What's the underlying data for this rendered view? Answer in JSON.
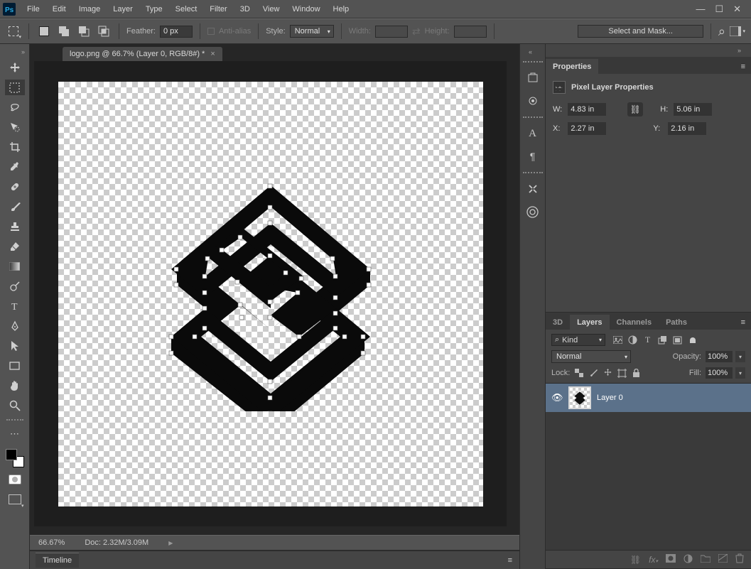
{
  "app": {
    "menus": [
      "File",
      "Edit",
      "Image",
      "Layer",
      "Type",
      "Select",
      "Filter",
      "3D",
      "View",
      "Window",
      "Help"
    ]
  },
  "options": {
    "feather_label": "Feather:",
    "feather_value": "0 px",
    "antialias_label": "Anti-alias",
    "style_label": "Style:",
    "style_value": "Normal",
    "width_label": "Width:",
    "height_label": "Height:",
    "select_mask": "Select and Mask..."
  },
  "document": {
    "tab_title": "logo.png @ 66.7% (Layer 0, RGB/8#) *"
  },
  "status": {
    "zoom": "66.67%",
    "doc_info": "Doc: 2.32M/3.09M"
  },
  "timeline": {
    "label": "Timeline"
  },
  "properties": {
    "panel_title": "Properties",
    "header": "Pixel Layer Properties",
    "w_label": "W:",
    "w_value": "4.83 in",
    "h_label": "H:",
    "h_value": "5.06 in",
    "x_label": "X:",
    "x_value": "2.27 in",
    "y_label": "Y:",
    "y_value": "2.16 in"
  },
  "layers": {
    "tabs": [
      "3D",
      "Layers",
      "Channels",
      "Paths"
    ],
    "search_kind": "Kind",
    "blend_mode": "Normal",
    "opacity_label": "Opacity:",
    "opacity_value": "100%",
    "lock_label": "Lock:",
    "fill_label": "Fill:",
    "fill_value": "100%",
    "layer_name": "Layer 0"
  }
}
